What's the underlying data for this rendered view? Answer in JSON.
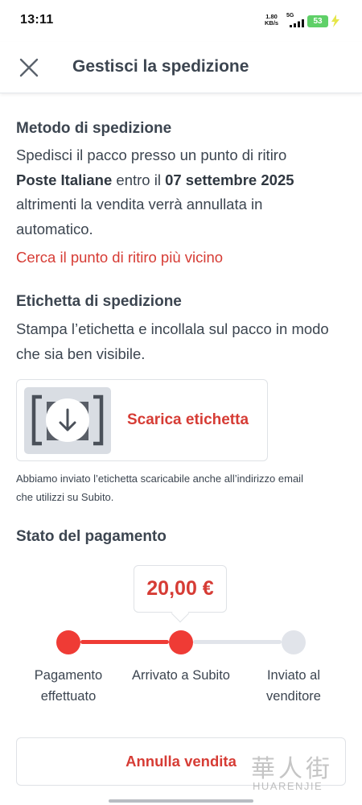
{
  "status_bar": {
    "time": "13:11",
    "speed_value": "1.80",
    "speed_unit": "KB/s",
    "network": "5G",
    "battery": "53"
  },
  "header": {
    "title": "Gestisci la spedizione",
    "close_icon": "close-icon"
  },
  "shipping_method": {
    "title": "Metodo di spedizione",
    "text_1": "Spedisci il pacco presso un punto di ritiro",
    "carrier": "Poste Italiane",
    "text_2": " entro il ",
    "deadline": "07 settembre 2025",
    "text_3": "altrimenti la vendita verrà annullata in",
    "text_4": "automatico.",
    "link": "Cerca il punto di ritiro più vicino"
  },
  "shipping_label": {
    "title": "Etichetta di spedizione",
    "line_1": "Stampa l’etichetta e incollala sul pacco in modo",
    "line_2": "che sia ben visibile.",
    "download_label": "Scarica etichetta",
    "download_icon": "download-icon",
    "note_1": "Abbiamo inviato l’etichetta scaricabile anche all’indirizzo email",
    "note_2": "che utilizzi su Subito."
  },
  "payment_status": {
    "title": "Stato del pagamento",
    "amount": "20,00 €",
    "steps": [
      {
        "line1": "Pagamento",
        "line2": "effettuato",
        "done": true
      },
      {
        "line1": "Arrivato a Subito",
        "line2": "",
        "done": true
      },
      {
        "line1": "Inviato al",
        "line2": "venditore",
        "done": false
      }
    ],
    "colors": {
      "active": "#ef3b35",
      "inactive": "#e1e4ea"
    }
  },
  "actions": {
    "cancel_label": "Annulla vendita"
  },
  "watermark": {
    "cn": "華人街",
    "en": "HUARENJIE"
  }
}
